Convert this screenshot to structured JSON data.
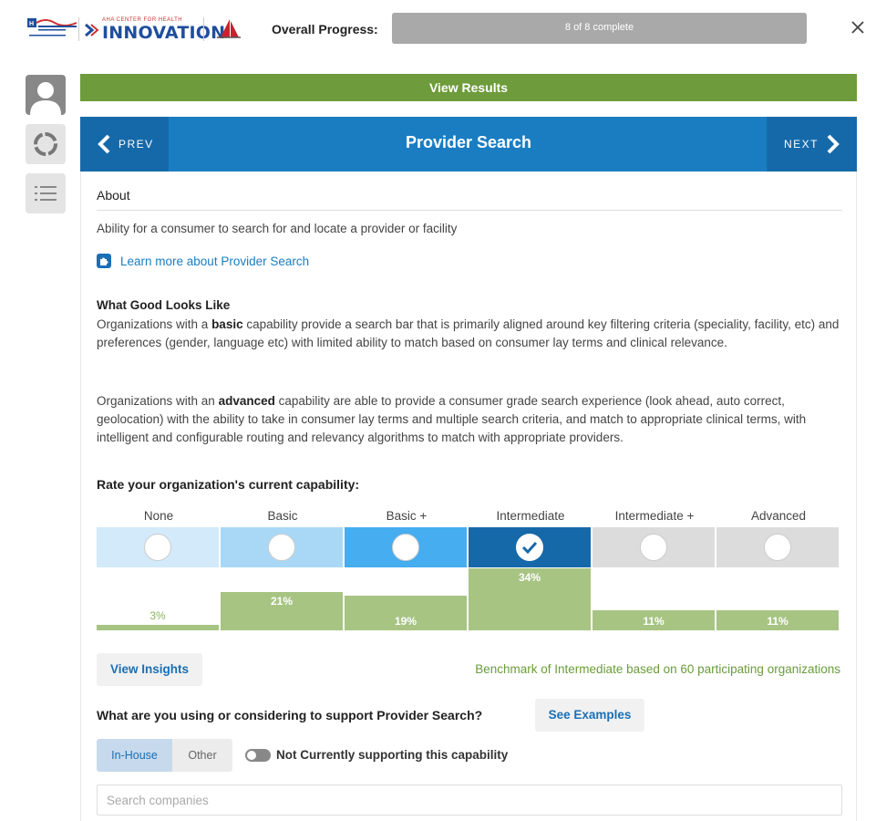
{
  "header": {
    "logo_aha_alt": "American Hospital Association",
    "logo_center_small": "AHA CENTER FOR HEALTH",
    "logo_center_big": "INNOVATION",
    "progress_label": "Overall Progress:",
    "progress_text": "8 of 8 complete",
    "progress_fraction": 1.0,
    "close_icon": "close-icon"
  },
  "rail": {
    "avatar_icon": "user-avatar-icon",
    "progress_icon": "circle-progress-icon",
    "list_icon": "list-icon"
  },
  "view_results_label": "View Results",
  "nav": {
    "prev_label": "PREV",
    "next_label": "NEXT",
    "title": "Provider Search"
  },
  "about": {
    "heading": "About",
    "text": "Ability for a consumer to search for and locate a provider or facility",
    "learn_more": "Learn more about Provider Search"
  },
  "what_good": {
    "heading": "What Good Looks Like",
    "basic_pre": "Organizations with a ",
    "basic_bold": "basic",
    "basic_post": " capability provide a search bar that is primarily aligned around key filtering criteria (speciality, facility, etc) and preferences (gender, language etc) with limited ability to match based on consumer lay terms and clinical relevance.",
    "adv_pre": "Organizations with an ",
    "adv_bold": "advanced",
    "adv_post": " capability are able to provide a consumer grade search experience (look ahead, auto correct, geolocation) with the ability to take in consumer lay terms and multiple search criteria, and match to appropriate clinical terms, with intelligent and configurable routing and relevancy algorithms to match with appropriate providers."
  },
  "rating": {
    "heading": "Rate your organization's current capability:",
    "levels": [
      {
        "label": "None",
        "color": "#d3eafa",
        "selected": false,
        "pct_label": "3%",
        "pct": 3
      },
      {
        "label": "Basic",
        "color": "#a8d8f6",
        "selected": false,
        "pct_label": "21%",
        "pct": 21
      },
      {
        "label": "Basic +",
        "color": "#45adf0",
        "selected": false,
        "pct_label": "19%",
        "pct": 19
      },
      {
        "label": "Intermediate",
        "color": "#1669a9",
        "selected": true,
        "pct_label": "34%",
        "pct": 34
      },
      {
        "label": "Intermediate +",
        "color": "#dcdcdc",
        "selected": false,
        "pct_label": "11%",
        "pct": 11
      },
      {
        "label": "Advanced",
        "color": "#dcdcdc",
        "selected": false,
        "pct_label": "11%",
        "pct": 11
      }
    ],
    "view_insights": "View Insights",
    "benchmark": "Benchmark of Intermediate based on 60 participating organizations"
  },
  "support": {
    "heading": "What are you using or considering to support Provider Search?",
    "see_examples": "See Examples",
    "tab_inhouse": "In-House",
    "tab_other": "Other",
    "toggle_label": "Not Currently supporting this capability",
    "search_placeholder": "Search companies",
    "search_value": ""
  },
  "colors": {
    "green": "#6e9b3b",
    "blue": "#1a7dc2",
    "blue_dark": "#1669a9",
    "bar_green": "#a7c483"
  }
}
